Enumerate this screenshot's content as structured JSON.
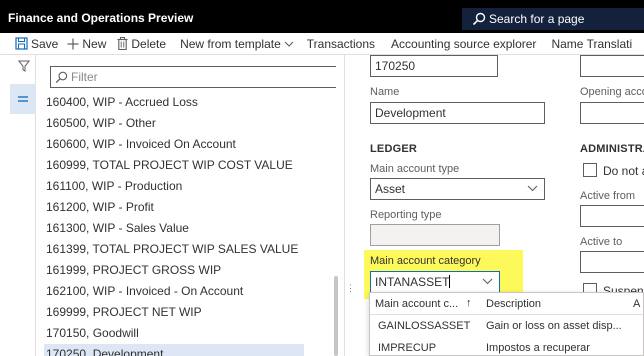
{
  "app": {
    "title": "Finance and Operations Preview"
  },
  "search": {
    "label": "Search for a page"
  },
  "toolbar": {
    "save": "Save",
    "new": "New",
    "delete": "Delete",
    "new_from_template": "New from template",
    "transactions": "Transactions",
    "accounting_source_explorer": "Accounting source explorer",
    "name_translations": "Name Translati"
  },
  "list": {
    "filter_placeholder": "Filter",
    "items": [
      "160400, WIP - Accrued Loss",
      "160500, WIP - Other",
      "160600, WIP - Invoiced On Account",
      "160999, TOTAL PROJECT WIP COST VALUE",
      "161100, WIP - Production",
      "161200, WIP - Profit",
      "161300, WIP - Sales Value",
      "161399, TOTAL PROJECT WIP SALES VALUE",
      "161999, PROJECT GROSS WIP",
      "162100, WIP - Invoiced - On Account",
      "169999, PROJECT NET WIP",
      "170150, Goodwill",
      "170250, Development"
    ]
  },
  "detail": {
    "main_account_value": "170250",
    "name_label": "Name",
    "name_value": "Development",
    "ledger_header": "LEDGER",
    "main_account_type_label": "Main account type",
    "main_account_type_value": "Asset",
    "reporting_type_label": "Reporting type",
    "main_account_category_label": "Main account category",
    "main_account_category_value": "INTANASSET",
    "opening_account_label": "Opening acco",
    "administration_header": "ADMINISTRA",
    "do_not_allow_label": "Do not a",
    "active_from_label": "Active from",
    "active_to_label": "Active to",
    "suspended_label": "Suspend"
  },
  "dropdown": {
    "col1_header": "Main account c...",
    "col2_header": "Description",
    "col3_header": "A",
    "sort_indicator": "↑",
    "rows": [
      {
        "code": "GAINLOSSASSET",
        "description": "Gain or loss on asset disp..."
      },
      {
        "code": "IMPRECUP",
        "description": "Impostos a recuperar"
      }
    ]
  },
  "colors": {
    "titlebar": "#000000",
    "search_bg": "#13213d",
    "highlight": "#fef95a",
    "selection": "#dce6f4",
    "accent": "#0f6cbd"
  }
}
